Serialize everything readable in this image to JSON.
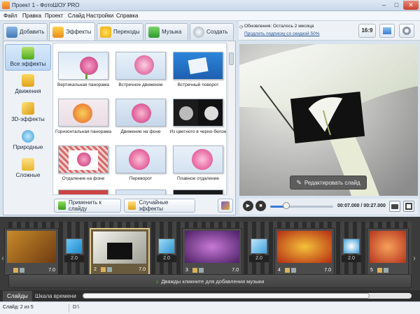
{
  "window": {
    "title": "Проект 1 - ФотоШОУ PRO",
    "btn_min": "–",
    "btn_max": "□",
    "btn_close": "✕"
  },
  "menu": [
    "Файл",
    "Правка",
    "Проект",
    "Слайд",
    "Настройки",
    "Справка"
  ],
  "tabs": [
    "Добавить",
    "Эффекты",
    "Переходы",
    "Музыка",
    "Создать"
  ],
  "updates": {
    "line1": "Обновления: Осталось 2 месяца",
    "line2": "Продлить подписку со скидкой 50%"
  },
  "aspect_label": "16:9",
  "categories": [
    "Все эффекты",
    "Движения",
    "3D-эффекты",
    "Природные",
    "Сложные"
  ],
  "effects": [
    "Вертикальная панорама",
    "Встречное движение",
    "Встречный поворот",
    "Горизонтальная панорама",
    "Движение на фоне",
    "Из цветного в черно-белое",
    "Отдаление на фоне",
    "Переворот",
    "Плавное отдаление"
  ],
  "actions": {
    "apply": "Применить к слайду",
    "random": "Случайные эффекты"
  },
  "preview": {
    "edit_button": "Редактировать слайд",
    "time": "00:07.000 / 00:27.000"
  },
  "slides": [
    {
      "num": "",
      "duration": "7.0"
    },
    {
      "num": "2",
      "duration": "7.0"
    },
    {
      "num": "3",
      "duration": "7.0"
    },
    {
      "num": "4",
      "duration": "7.0"
    },
    {
      "num": "5",
      "duration": "7.0"
    }
  ],
  "transitions": [
    "2.0",
    "2.0",
    "2.0",
    "2.0"
  ],
  "music_hint": "Дважды кликните для добавления музыки",
  "bottom_tabs": [
    "Слайды",
    "Шкала времени"
  ],
  "status": {
    "left": "Слайд: 2 из 5",
    "right": "D:\\"
  },
  "colors": {
    "accent": "#3a7bd5",
    "selected_slide": "#e0c68a",
    "timeline_bg": "#3b3b3b"
  }
}
